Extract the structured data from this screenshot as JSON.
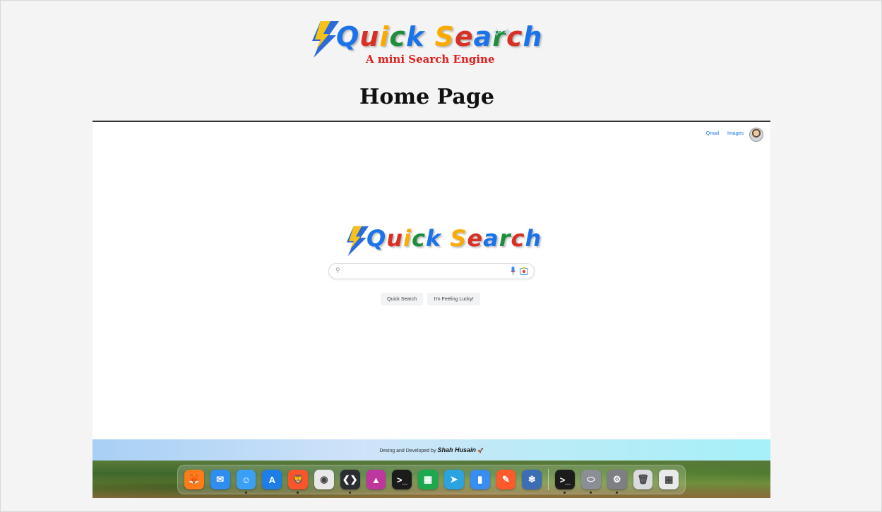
{
  "header": {
    "logo_text": "Quick Search",
    "tagline": "A mini Search Engine",
    "page_title": "Home Page"
  },
  "screen": {
    "top_links": {
      "mail": "Qmail",
      "images": "Images"
    },
    "logo_text": "Quick Search",
    "search": {
      "value": "",
      "placeholder": ""
    },
    "buttons": {
      "search": "Quick Search",
      "lucky": "I'm Feeling Lucky!"
    },
    "footer": {
      "prefix": "Desing and Developed by",
      "author": "Shah Husain",
      "emoji": "🚀"
    }
  },
  "logo_letters": [
    {
      "ch": "Q",
      "color": "#1a73e8"
    },
    {
      "ch": "u",
      "color": "#d93025"
    },
    {
      "ch": "i",
      "color": "#f9ab00"
    },
    {
      "ch": "c",
      "color": "#1e8e3e"
    },
    {
      "ch": "k",
      "color": "#1a73e8"
    },
    {
      "ch": " ",
      "color": "#000000"
    },
    {
      "ch": "S",
      "color": "#f9ab00"
    },
    {
      "ch": "e",
      "color": "#d93025"
    },
    {
      "ch": "a",
      "color": "#1a73e8"
    },
    {
      "ch": "r",
      "color": "#1e8e3e"
    },
    {
      "ch": "c",
      "color": "#d93025"
    },
    {
      "ch": "h",
      "color": "#1a73e8"
    }
  ],
  "dock_apps": [
    {
      "name": "firefox-icon",
      "glyph": "🦊",
      "bg": "#ff7a18",
      "dot": false
    },
    {
      "name": "mail-icon",
      "glyph": "✉",
      "bg": "#2f8cf0",
      "dot": false
    },
    {
      "name": "finder-icon",
      "glyph": "☺",
      "bg": "#3aa0f5",
      "dot": true
    },
    {
      "name": "app-store-icon",
      "glyph": "A",
      "bg": "#1f7de6",
      "dot": false
    },
    {
      "name": "brave-icon",
      "glyph": "🦁",
      "bg": "#fb542b",
      "dot": true
    },
    {
      "name": "chrome-icon",
      "glyph": "◉",
      "bg": "#e8e8e8",
      "dot": false
    },
    {
      "name": "vscode-icon",
      "glyph": "❮❯",
      "bg": "#2b2d31",
      "dot": true
    },
    {
      "name": "nova-icon",
      "glyph": "▲",
      "bg": "#c0369f",
      "dot": false
    },
    {
      "name": "terminal-pink-icon",
      "glyph": ">_",
      "bg": "#1b1b1b",
      "dot": false
    },
    {
      "name": "numbers-icon",
      "glyph": "▦",
      "bg": "#1ca84f",
      "dot": false
    },
    {
      "name": "telegram-icon",
      "glyph": "➤",
      "bg": "#2aa3e0",
      "dot": false
    },
    {
      "name": "bookmarks-icon",
      "glyph": "▮",
      "bg": "#3a8df0",
      "dot": false
    },
    {
      "name": "paw-icon",
      "glyph": "✎",
      "bg": "#ff5a2b",
      "dot": false
    },
    {
      "name": "screenshot-icon",
      "glyph": "❄",
      "bg": "#3d6eb5",
      "dot": false
    },
    {
      "name": "separator",
      "glyph": "",
      "bg": "",
      "dot": false
    },
    {
      "name": "terminal-icon",
      "glyph": ">_",
      "bg": "#1c1c1c",
      "dot": true
    },
    {
      "name": "disk-utility-icon",
      "glyph": "⬭",
      "bg": "#8a8f96",
      "dot": true
    },
    {
      "name": "system-settings-icon",
      "glyph": "⚙",
      "bg": "#7d7f84",
      "dot": true
    },
    {
      "name": "trash-icon",
      "glyph": "🗑",
      "bg": "#d9dbde",
      "dot": false
    },
    {
      "name": "launchpad-icon",
      "glyph": "▦",
      "bg": "#eaeaea",
      "dot": false
    }
  ]
}
